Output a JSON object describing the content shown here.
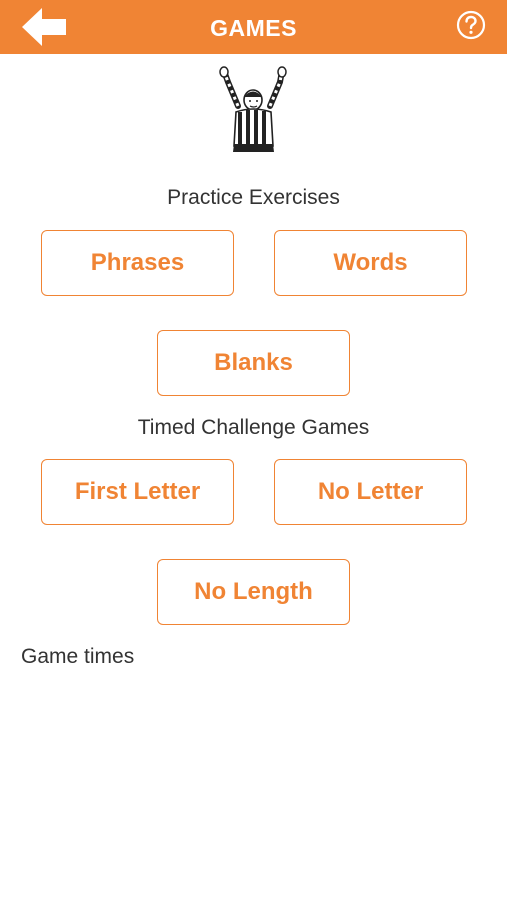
{
  "header": {
    "title": "GAMES",
    "back_icon": "arrow-left-icon",
    "help_icon": "question-circle-icon",
    "bar_color": "#f08434"
  },
  "illustration": {
    "icon": "referee-touchdown-icon"
  },
  "practice": {
    "label": "Practice Exercises",
    "buttons": [
      "Phrases",
      "Words",
      "Blanks"
    ]
  },
  "timed": {
    "label": "Timed Challenge Games",
    "buttons": [
      "First Letter",
      "No Letter",
      "No Length"
    ]
  },
  "game_times": {
    "label": "Game times"
  },
  "colors": {
    "accent": "#f08434",
    "text": "#333333",
    "background": "#ffffff"
  }
}
